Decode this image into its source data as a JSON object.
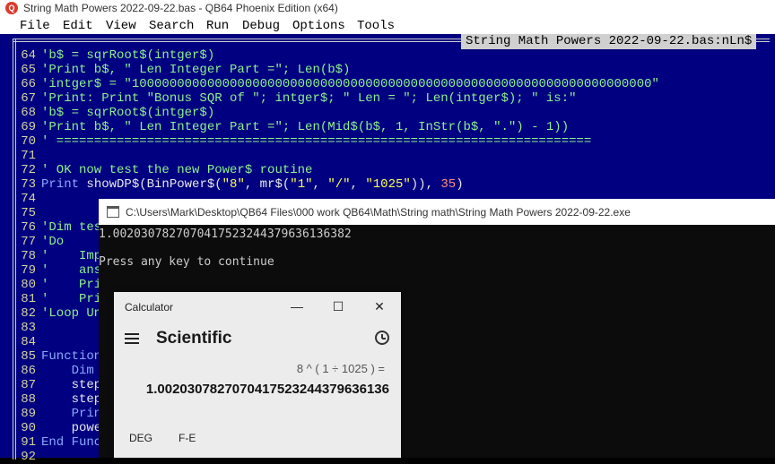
{
  "qb64": {
    "window_title": "String Math Powers 2022-09-22.bas - QB64 Phoenix Edition (x64)",
    "app_icon_glyph": "Q",
    "menu": [
      "File",
      "Edit",
      "View",
      "Search",
      "Run",
      "Debug",
      "Options",
      "Tools"
    ],
    "file_tab": "String Math Powers 2022-09-22.bas:nLn$",
    "code_lines": [
      {
        "n": "64",
        "text": "'b$ = sqrRoot$(intger$)"
      },
      {
        "n": "65",
        "text": "'Print b$, \" Len Integer Part =\"; Len(b$)"
      },
      {
        "n": "66",
        "text": "'intger$ = \"100000000000000000000000000000000000000000000000000000000000000000000\""
      },
      {
        "n": "67",
        "text": "'Print: Print \"Bonus SQR of \"; intger$; \" Len = \"; Len(intger$); \" is:\""
      },
      {
        "n": "68",
        "text": "'b$ = sqrRoot$(intger$)"
      },
      {
        "n": "69",
        "text": "'Print b$, \" Len Integer Part =\"; Len(Mid$(b$, 1, InStr(b$, \".\") - 1))"
      },
      {
        "n": "70",
        "text": "' ======================================================================="
      },
      {
        "n": "71",
        "text": ""
      },
      {
        "n": "72",
        "text": "' OK now test the new Power$ routine"
      },
      {
        "n": "73",
        "text": ""
      },
      {
        "n": "74",
        "text": ""
      },
      {
        "n": "75",
        "text": ""
      },
      {
        "n": "76",
        "text": "'Dim tes"
      },
      {
        "n": "77",
        "text": "'Do"
      },
      {
        "n": "78",
        "text": "'    Imp"
      },
      {
        "n": "79",
        "text": "'    ans"
      },
      {
        "n": "80",
        "text": "'    Pri"
      },
      {
        "n": "81",
        "text": "'    Pri"
      },
      {
        "n": "82",
        "text": "'Loop Un"
      },
      {
        "n": "83",
        "text": ""
      },
      {
        "n": "84",
        "text": ""
      },
      {
        "n": "85",
        "text": "Function"
      },
      {
        "n": "86",
        "text": "    Dim"
      },
      {
        "n": "87",
        "text": "    step"
      },
      {
        "n": "88",
        "text": "    step"
      },
      {
        "n": "89",
        "text": "    Prin"
      },
      {
        "n": "90",
        "text": "    powe"
      },
      {
        "n": "91",
        "text": "End Func"
      },
      {
        "n": "92",
        "text": ""
      }
    ],
    "line73": {
      "kw": "Print",
      "p1": " showDP$(BinPower$(",
      "s1": "\"8\"",
      "p2": ", mr$(",
      "s2": "\"1\"",
      "p3": ", ",
      "s3": "\"/\"",
      "p4": ", ",
      "s4": "\"1025\"",
      "p5": ")), ",
      "num": "35",
      "p6": ")"
    }
  },
  "console": {
    "title": "C:\\Users\\Mark\\Desktop\\QB64 Files\\000 work QB64\\Math\\String math\\String Math Powers 2022-09-22.exe",
    "output_line": "1.0020307827070417523244379636136382",
    "prompt": "Press any key to continue"
  },
  "calculator": {
    "title": "Calculator",
    "minimize": "—",
    "maximize": "☐",
    "close": "✕",
    "mode": "Scientific",
    "expression": "8 ^ ( 1 ÷ 1025 ) =",
    "result": "1.0020307827070417523244379636136",
    "deg_label": "DEG",
    "fe_label": "F-E"
  }
}
